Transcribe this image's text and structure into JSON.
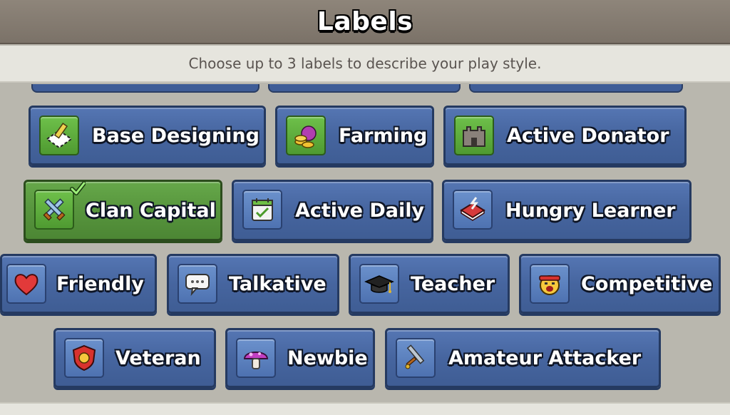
{
  "header": {
    "title": "Labels"
  },
  "instructions": "Choose up to 3 labels to describe your play style.",
  "labels": [
    {
      "text": "Base Designing",
      "icon": "base-designing-icon",
      "selected": false
    },
    {
      "text": "Farming",
      "icon": "farming-icon",
      "selected": false
    },
    {
      "text": "Active Donator",
      "icon": "active-donator-icon",
      "selected": false
    },
    {
      "text": "Clan Capital",
      "icon": "clan-capital-icon",
      "selected": true
    },
    {
      "text": "Active Daily",
      "icon": "active-daily-icon",
      "selected": false
    },
    {
      "text": "Hungry Learner",
      "icon": "hungry-learner-icon",
      "selected": false
    },
    {
      "text": "Friendly",
      "icon": "friendly-heart-icon",
      "selected": false
    },
    {
      "text": "Talkative",
      "icon": "talkative-speech-bubble-icon",
      "selected": false
    },
    {
      "text": "Teacher",
      "icon": "teacher-cap-icon",
      "selected": false
    },
    {
      "text": "Competitive",
      "icon": "competitive-face-icon",
      "selected": false
    },
    {
      "text": "Veteran",
      "icon": "veteran-shield-icon",
      "selected": false
    },
    {
      "text": "Newbie",
      "icon": "newbie-mushroom-icon",
      "selected": false
    },
    {
      "text": "Amateur Attacker",
      "icon": "amateur-attacker-sword-icon",
      "selected": false
    }
  ],
  "colors": {
    "button_blue": "#46659f",
    "button_selected_green": "#57953d",
    "header_brown": "#857c71",
    "panel_beige": "#b9b7ae"
  }
}
